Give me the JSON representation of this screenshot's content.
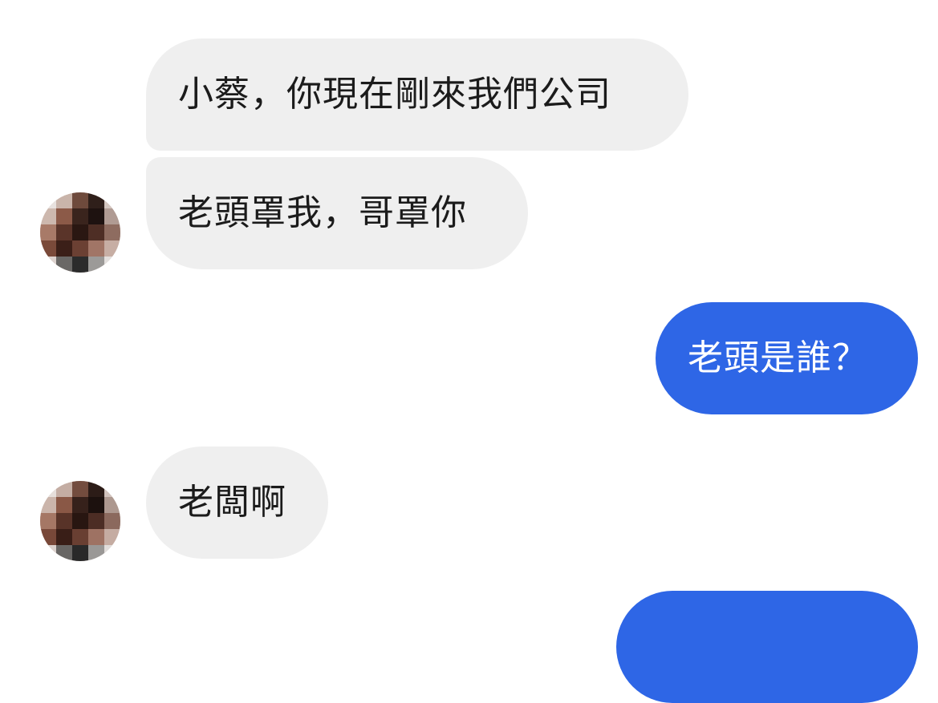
{
  "messages": [
    {
      "id": "m1",
      "direction": "incoming",
      "text": "小蔡，你現在剛來我們公司"
    },
    {
      "id": "m2",
      "direction": "incoming",
      "text": "老頭罩我，哥罩你"
    },
    {
      "id": "m3",
      "direction": "outgoing",
      "text": "老頭是誰？"
    },
    {
      "id": "m4",
      "direction": "incoming",
      "text": "老闆啊"
    },
    {
      "id": "m5",
      "direction": "outgoing",
      "text": "",
      "note_visible": "partially cut off at bottom edge"
    }
  ],
  "colors": {
    "incoming_bubble": "#efefef",
    "incoming_text": "#1b1b1b",
    "outgoing_bubble": "#2e66e6",
    "outgoing_text": "#ffffff",
    "background": "#ffffff"
  },
  "icons": {
    "avatar": "pixelated-profile-photo"
  }
}
